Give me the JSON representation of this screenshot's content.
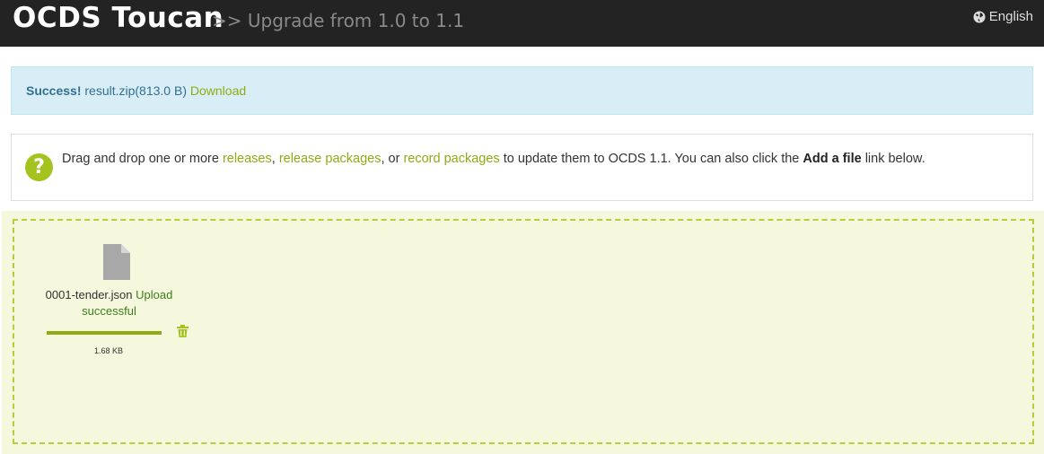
{
  "header": {
    "brand": "OCDS Toucan",
    "subtitle": ">> Upgrade from 1.0 to 1.1",
    "language": "English",
    "language_icon": "globe-icon"
  },
  "alert": {
    "strong": "Success!",
    "file": "result.zip(813.0 B)",
    "download_label": "Download"
  },
  "info": {
    "icon": "question-icon",
    "icon_glyph": "?",
    "text_1": "Drag and drop one or more ",
    "link_releases": "releases",
    "text_2": ", ",
    "link_release_packages": "release packages",
    "text_3": ", or ",
    "link_record_packages": "record packages",
    "text_4": " to update them to OCDS 1.1. You can also click the ",
    "bold_add": "Add a file",
    "text_5": " link below."
  },
  "dropzone": {
    "file": {
      "name": "0001-tender.json",
      "status": "Upload successful",
      "size": "1.68 KB",
      "progress": 1.0,
      "icon": "file-icon",
      "remove_icon": "trash-icon"
    }
  },
  "colors": {
    "header_bg": "#232323",
    "accent": "#8fab14",
    "alert_bg": "#d9edf7",
    "dropzone_bg": "#f5f8dc"
  }
}
